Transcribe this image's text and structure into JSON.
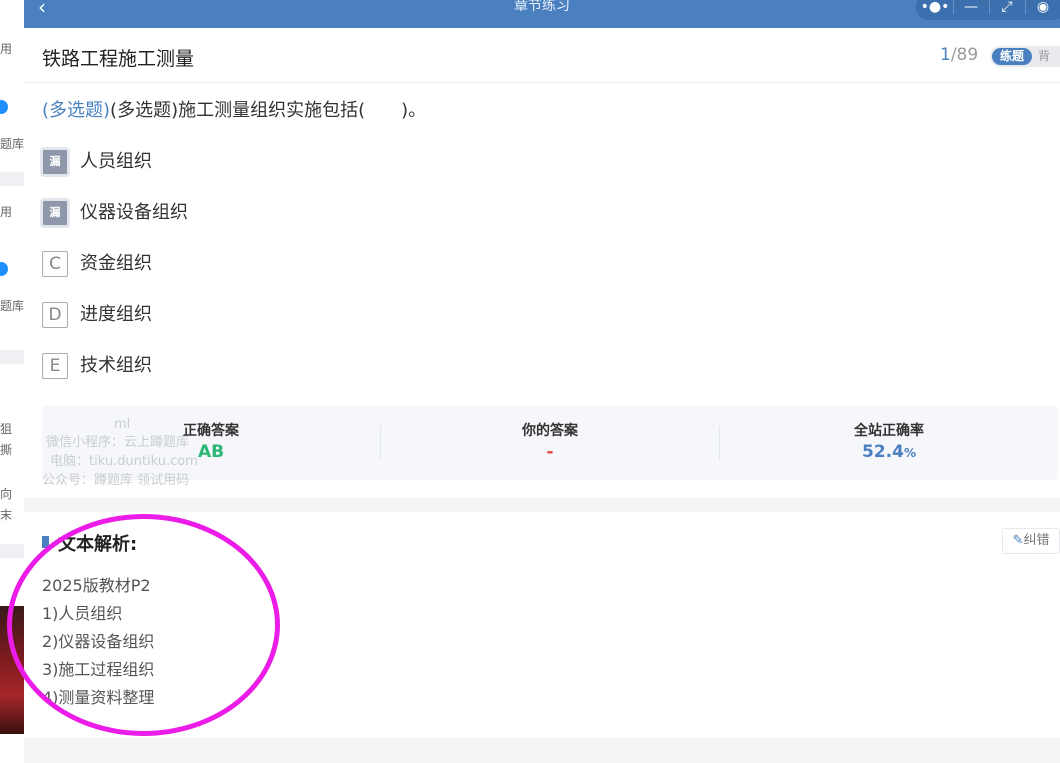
{
  "background_window": {
    "texts": [
      "用",
      "题库",
      "用",
      "题库",
      "狙",
      "撕",
      "向",
      "末"
    ]
  },
  "window": {
    "title": "章节练习",
    "back_glyph": "‹",
    "capsule": {
      "more": "•●•",
      "minimize": "—",
      "restore": "⤢",
      "close": "◉"
    }
  },
  "header": {
    "title": "铁路工程施工测量",
    "current": "1",
    "total": "/89",
    "mode_active": "练题",
    "mode_inactive": "背"
  },
  "question": {
    "type_tag": "(多选题)",
    "text": "(多选题)施工测量组织实施包括(　　)。"
  },
  "options": [
    {
      "badge": "漏",
      "text": "人员组织",
      "state": "missed"
    },
    {
      "badge": "漏",
      "text": "仪器设备组织",
      "state": "missed"
    },
    {
      "badge": "C",
      "text": "资金组织",
      "state": "normal"
    },
    {
      "badge": "D",
      "text": "进度组织",
      "state": "normal"
    },
    {
      "badge": "E",
      "text": "技术组织",
      "state": "normal"
    }
  ],
  "stats": {
    "correct_label": "正确答案",
    "correct_value": "AB",
    "yours_label": "你的答案",
    "yours_value": "-",
    "rate_label": "全站正确率",
    "rate_value": "52.4",
    "rate_unit": "%"
  },
  "watermark": {
    "lines": [
      "ml",
      "微信小程序：云上蹲题库",
      "电脑：tiku.duntiku.com",
      "公众号：蹲题库 领试用码"
    ]
  },
  "analysis": {
    "title": "文本解析:",
    "report_label": "纠错",
    "lines": [
      "2025版教材P2",
      "1)人员组织",
      "2)仪器设备组织",
      "3)施工过程组织",
      "4)测量资料整理"
    ]
  },
  "colors": {
    "brand": "#4a80c0",
    "correct": "#2bb673",
    "wrong": "#e0473d",
    "annotation": "#ec1ce8"
  }
}
